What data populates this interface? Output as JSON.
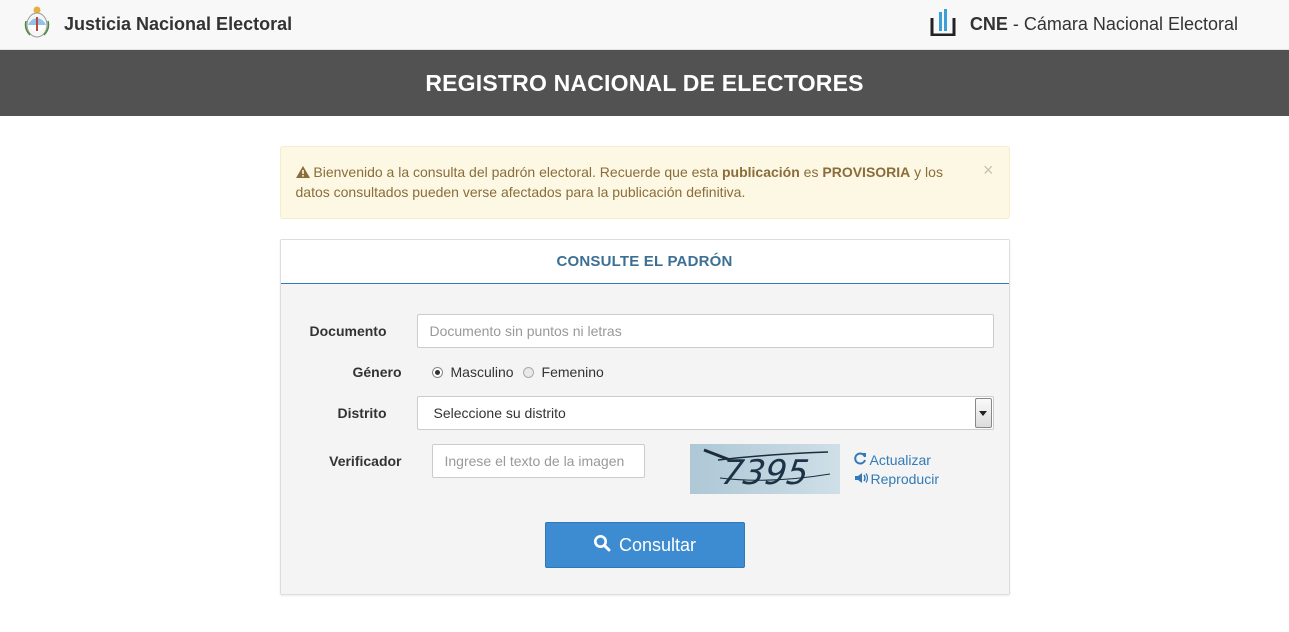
{
  "header": {
    "left_title": "Justicia Nacional Electoral",
    "right_abbr": "CNE",
    "right_separator": " - ",
    "right_title": "Cámara Nacional Electoral"
  },
  "band": {
    "title": "REGISTRO NACIONAL DE ELECTORES"
  },
  "alert": {
    "text_1": "Bienvenido a la consulta del padrón electoral. Recuerde que esta ",
    "bold_1": "publicación",
    "text_2": " es ",
    "bold_2": "PROVISORIA",
    "text_3": " y los datos consultados pueden verse afectados para la publicación definitiva.",
    "close_glyph": "×"
  },
  "panel": {
    "title": "CONSULTE EL PADRÓN"
  },
  "form": {
    "documento_label": "Documento",
    "documento_placeholder": "Documento sin puntos ni letras",
    "genero_label": "Género",
    "genero_options": [
      "Masculino",
      "Femenino"
    ],
    "genero_selected": "Masculino",
    "distrito_label": "Distrito",
    "distrito_value": "Seleccione su distrito",
    "verificador_label": "Verificador",
    "verificador_placeholder": "Ingrese el texto de la imagen",
    "captcha_text": "7395",
    "refresh_label": "Actualizar",
    "audio_label": "Reproducir",
    "submit_label": "Consultar"
  },
  "icons": {
    "left_logo": "argentina-coat-of-arms-icon",
    "right_logo": "cne-logo-icon",
    "warning": "warning-triangle-icon",
    "refresh": "refresh-icon",
    "audio": "volume-icon",
    "search": "search-icon"
  },
  "colors": {
    "accent": "#337ab7",
    "button": "#3d8bd0",
    "band": "#525252",
    "alert_bg": "#fcf8e3"
  }
}
